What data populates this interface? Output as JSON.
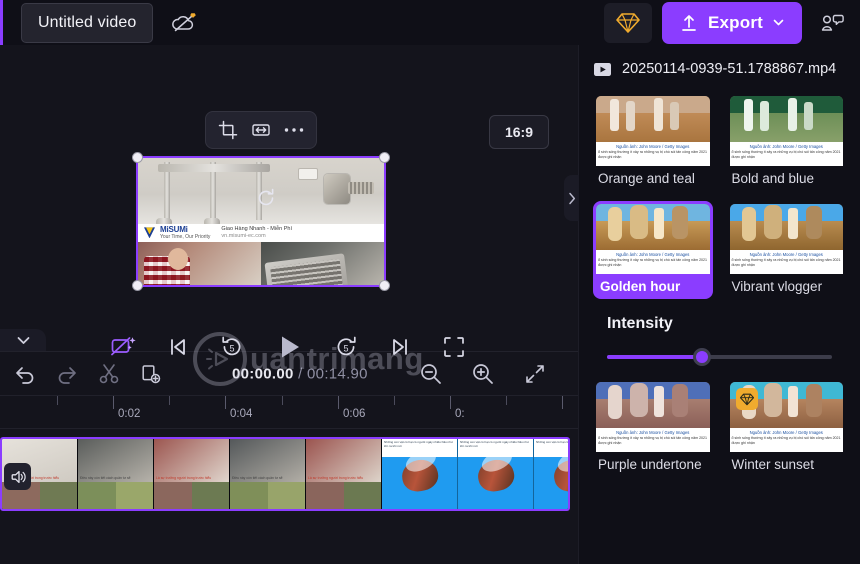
{
  "topbar": {
    "project_title": "Untitled video",
    "cloud_icon": "cloud-off-icon",
    "gem_icon": "premium-diamond-icon",
    "export_label": "Export",
    "export_icon": "upload-icon",
    "export_chevron": "chevron-down-icon",
    "people_icon": "collaborators-icon",
    "accent_color": "#8b3dff"
  },
  "stage": {
    "toolbar": {
      "crop_icon": "crop-icon",
      "fit_icon": "flip-horizontal-icon",
      "more_icon": "more-options-icon"
    },
    "aspect_ratio": "16:9",
    "watermark_text": "uantrimang",
    "video": {
      "brand": "MiSUMi",
      "brand_tagline": "Your Time, Our Priority",
      "headline": "Giao Hàng Nhanh - Miễn Phí",
      "subline": "vn.misumi-ec.com"
    }
  },
  "playback": {
    "controls": [
      {
        "name": "auto-enhance-toggle",
        "icon": "magic-filter-icon"
      },
      {
        "name": "skip-to-start-button",
        "icon": "skip-previous-icon"
      },
      {
        "name": "rewind-5s-button",
        "icon": "replay-5-icon",
        "label": "5"
      },
      {
        "name": "play-button",
        "icon": "play-icon"
      },
      {
        "name": "forward-5s-button",
        "icon": "forward-5-icon",
        "label": "5"
      },
      {
        "name": "skip-to-end-button",
        "icon": "skip-next-icon"
      },
      {
        "name": "fullscreen-button",
        "icon": "fullscreen-icon"
      }
    ]
  },
  "timeline": {
    "toolbar": {
      "undo_icon": "undo-icon",
      "redo_icon": "redo-icon",
      "split_icon": "scissors-icon",
      "duplicate_icon": "duplicate-icon",
      "zoom_out_icon": "zoom-out-icon",
      "zoom_in_icon": "zoom-in-icon",
      "fit_icon": "fit-to-screen-icon"
    },
    "current_time": "00:00.00",
    "separator": "/",
    "total_time": "00:14.90",
    "ruler_labels": [
      "0:02",
      "0:04",
      "0:06",
      "0:"
    ],
    "ruler_positions": [
      113,
      225,
      338,
      450
    ],
    "collapse_icon": "chevron-down-icon",
    "panel_handle_icon": "chevron-right-icon",
    "volume_icon": "volume-icon",
    "clip_selected": true
  },
  "right_panel": {
    "file_icon": "video-file-icon",
    "filename": "20250114-0939-51.1788867.mp4",
    "collapse_icon": "chevron-right-icon",
    "filters": [
      {
        "label": "Orange and teal",
        "selected": false,
        "premium": false,
        "sky": "#caa98b",
        "ground": "#b9norm",
        "ground_color": "#b98555",
        "leg": "#f1e7dc",
        "shadow": "#6d4a2e"
      },
      {
        "label": "Bold and blue",
        "selected": false,
        "premium": false,
        "sky": "#1f5b3a",
        "ground_color": "#7d9a62",
        "leg": "#eef5ee",
        "shadow": "#244d2c"
      },
      {
        "label": "Golden hour",
        "selected": true,
        "premium": false,
        "sky": "#6fb5e0",
        "ground_color": "#b08043",
        "leg": "#f6e7c8",
        "shadow": "#5e3f20"
      },
      {
        "label": "Vibrant vlogger",
        "selected": false,
        "premium": false,
        "sky": "#4aa8e8",
        "ground_color": "#a4763e",
        "leg": "#f3e6cd",
        "shadow": "#5a3d22"
      },
      {
        "label": "Purple undertone",
        "selected": false,
        "premium": false,
        "sky": "#4f6fb8",
        "ground_color": "#9a6e63",
        "leg": "#efe3dd",
        "shadow": "#553545"
      },
      {
        "label": "Winter sunset",
        "selected": false,
        "premium": true,
        "sky": "#3fb8d4",
        "ground_color": "#a57457",
        "leg": "#f2e3d4",
        "shadow": "#5c3a2a"
      }
    ],
    "thumb_caption": "Nguồn ảnh: John Moore / Getty Images",
    "thumb_body": "ổ sinh sống thường ít xảy ra những vụ bị chó sói tấn công năm 2021 được ghi nhận",
    "intensity_label": "Intensity",
    "intensity_value": 42,
    "premium_icon": "premium-diamond-icon"
  }
}
